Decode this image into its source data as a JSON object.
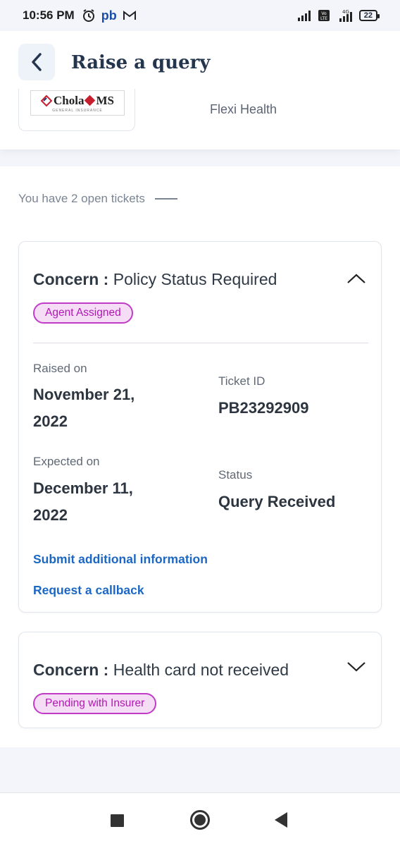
{
  "status_bar": {
    "time": "10:56 PM",
    "app_badge": "pb",
    "network": "4G",
    "volte": "Vo LTE",
    "battery": "22"
  },
  "header": {
    "title": "Raise a query",
    "insurer_logo_text": "Chola",
    "insurer_logo_text_2": "MS",
    "insurer_logo_sub": "GENERAL INSURANCE",
    "product_name": "Flexi Health"
  },
  "open_tickets_text": "You have 2 open tickets",
  "tickets": [
    {
      "concern_label": "Concern :",
      "concern": "Policy Status Required",
      "badge": "Agent Assigned",
      "raised_on_label": "Raised on",
      "raised_on_line1": "November 21,",
      "raised_on_line2": "2022",
      "ticket_id_label": "Ticket ID",
      "ticket_id": "PB23292909",
      "expected_on_label": "Expected on",
      "expected_on_line1": "December 11,",
      "expected_on_line2": "2022",
      "status_label": "Status",
      "status": "Query Received",
      "link_submit": "Submit additional information",
      "link_callback": "Request a callback"
    },
    {
      "concern_label": "Concern :",
      "concern": "Health card not received",
      "badge": "Pending with Insurer"
    }
  ],
  "colors": {
    "accent_link": "#1c67c4",
    "badge_border": "#c13cc6",
    "badge_bg": "#f6ddf6",
    "title": "#24364d"
  }
}
